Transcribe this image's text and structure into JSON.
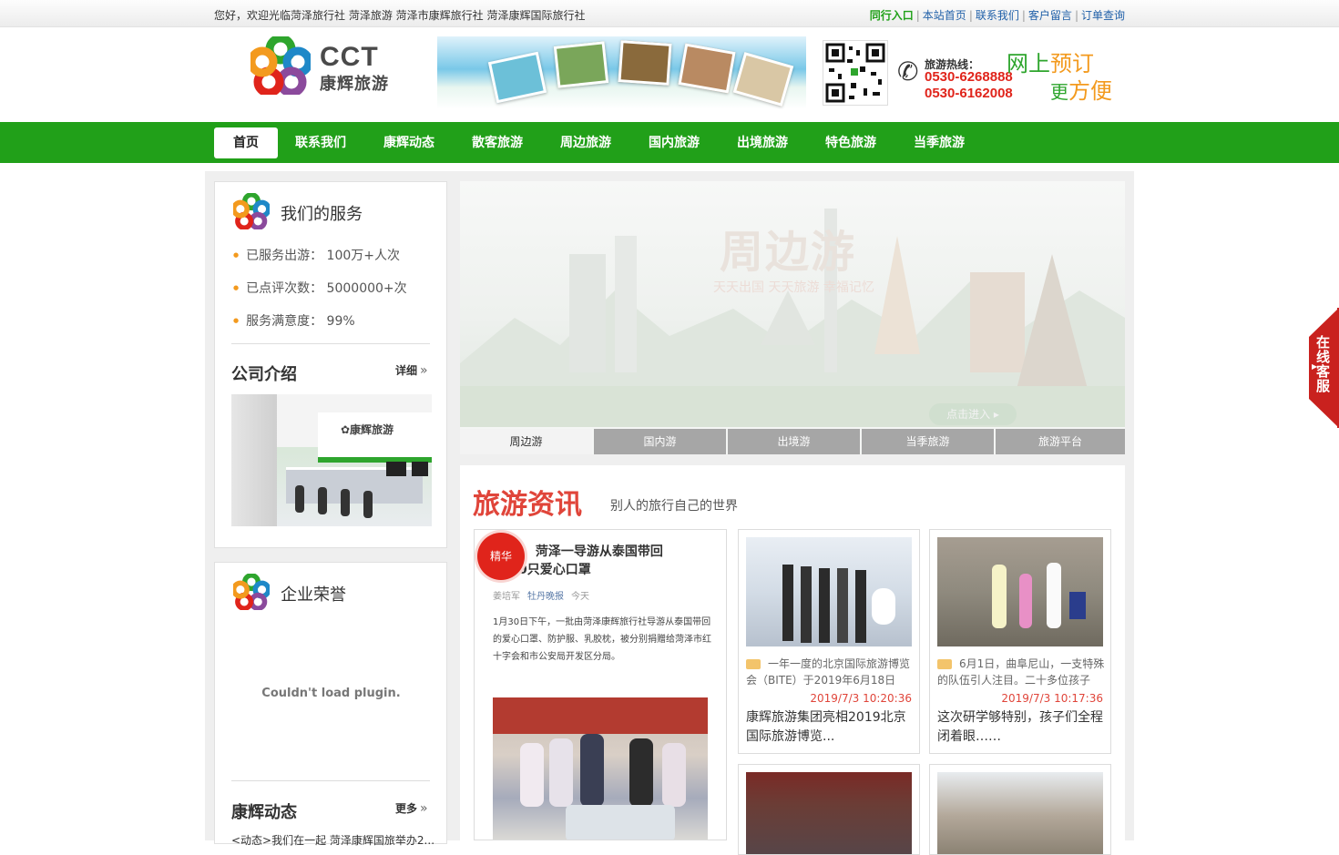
{
  "topbar": {
    "welcome": "您好，欢迎光临菏泽旅行社 菏泽旅游 菏泽市康辉旅行社 菏泽康辉国际旅行社",
    "links": [
      "同行入口",
      "本站首页",
      "联系我们",
      "客户留言",
      "订单查询"
    ]
  },
  "header": {
    "logo_cct": "CCT",
    "logo_cn": "康辉旅游",
    "hotline_label": "旅游热线：",
    "hotline_1": "0530-6268888",
    "hotline_2": "0530-6162008",
    "slogan_1a": "网上",
    "slogan_1b": "预订",
    "slogan_2a": "更",
    "slogan_2b": "方便"
  },
  "nav": {
    "items": [
      "首页",
      "联系我们",
      "康辉动态",
      "散客旅游",
      "周边旅游",
      "国内旅游",
      "出境旅游",
      "特色旅游",
      "当季旅游"
    ],
    "active_index": 0
  },
  "services": {
    "title": "我们的服务",
    "items": [
      "已服务出游：  100万+人次",
      "已点评次数：  5000000+次",
      "服务满意度：  99%"
    ]
  },
  "company": {
    "title": "公司介绍",
    "more": "详细"
  },
  "honors": {
    "title": "企业荣誉",
    "plugin_message": "Couldn't load plugin."
  },
  "dynamics": {
    "title": "康辉动态",
    "more": "更多",
    "first_item": "<动态>我们在一起 菏泽康辉国旅举办2..."
  },
  "slider": {
    "headline": "周边游",
    "tagline": "天天出国 天天旅游 幸福记忆",
    "enter": "点击进入 ▸",
    "tabs": [
      "周边游",
      "国内游",
      "出境游",
      "当季旅游",
      "旅游平台"
    ],
    "active_tab": 0
  },
  "travel_news": {
    "title": "旅游资讯",
    "subtitle": "别人的旅行自己的世界",
    "featured": {
      "badge": "精华",
      "headline_1": "！ 菏泽一导游从泰国带回",
      "headline_2": "0只爱心口罩",
      "author": "姜培军",
      "source": "牡丹晚报",
      "time": "今天",
      "body": "1月30日下午，一批由菏泽康辉旅行社导游从泰国带回的爱心口罩、防护服、乳胶枕，被分别捐赠给菏泽市红十字会和市公安局开发区分局。"
    },
    "cards": [
      {
        "desc": "一年一度的北京国际旅游博览会（BITE）于2019年6月18日",
        "date": "2019/7/3 10:20:36",
        "title": "康辉旅游集团亮相2019北京国际旅游博览..."
      },
      {
        "desc": "6月1日，曲阜尼山，一支特殊的队伍引人注目。二十多位孩子",
        "date": "2019/7/3 10:17:36",
        "title": "这次研学够特别，孩子们全程闭着眼……"
      }
    ]
  },
  "online_service": {
    "label": "在线客服"
  },
  "colors": {
    "brand_green": "#21a019",
    "news_red": "#e0453a",
    "accent_orange": "#f39a1e"
  }
}
